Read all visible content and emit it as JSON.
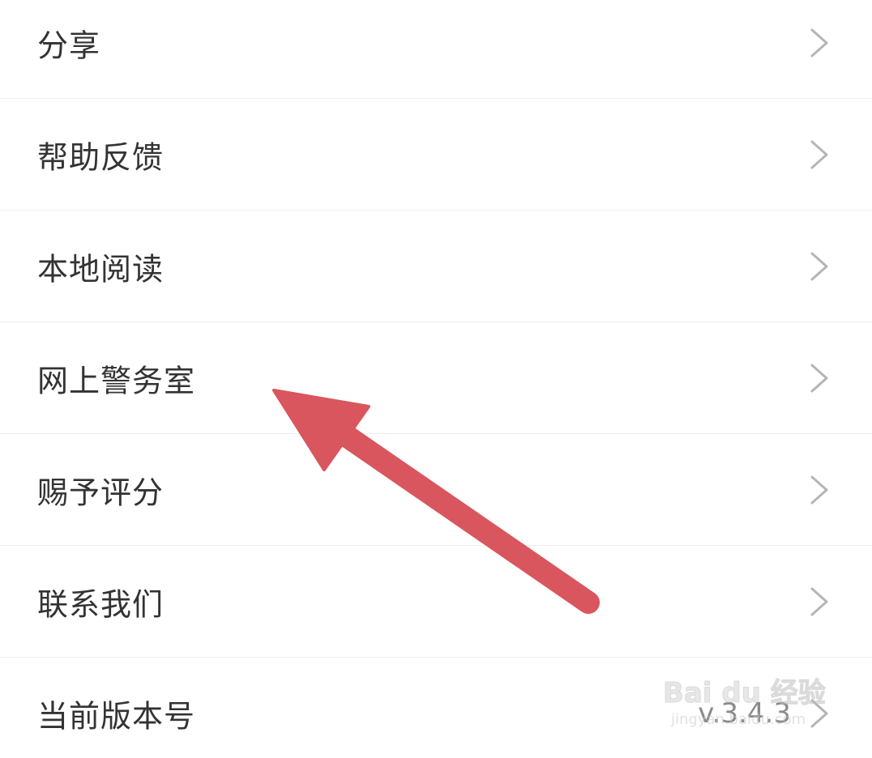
{
  "menu": {
    "items": [
      {
        "label": "分享"
      },
      {
        "label": "帮助反馈"
      },
      {
        "label": "本地阅读"
      },
      {
        "label": "网上警务室"
      },
      {
        "label": "赐予评分"
      },
      {
        "label": "联系我们"
      },
      {
        "label": "当前版本号",
        "value": "v.3.4.3"
      }
    ]
  },
  "watermark": {
    "brand": "Bai du 经验",
    "url": "jingyan.baidu.com"
  },
  "colors": {
    "label_text": "#333333",
    "chevron": "#b5b5b5",
    "divider": "#eeeeee",
    "arrow": "#d9565e"
  },
  "icons": {
    "row_chevron": "chevron-right-icon",
    "annotation": "red-arrow-icon"
  }
}
